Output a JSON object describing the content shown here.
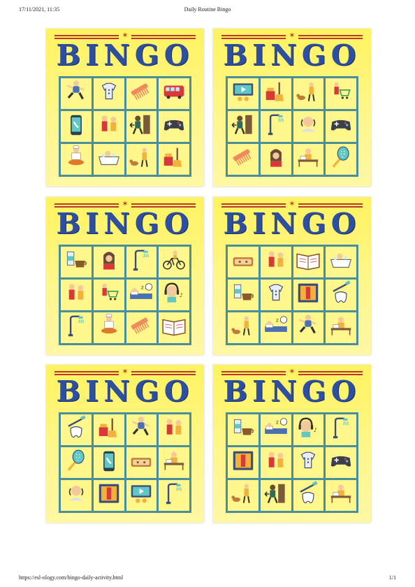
{
  "header": {
    "datetime": "17/11/2021, 11:35",
    "title": "Daily Routine Bingo"
  },
  "footer": {
    "url": "https://esl-ology.com/bingo-daily-activity.html",
    "page": "1/1"
  },
  "bingo_title": "BINGO",
  "cards": [
    {
      "cells": [
        "running-icon",
        "getting-dressed-icon",
        "comb-icon",
        "bus-icon",
        "phone-call-icon",
        "family-icon",
        "going-out-icon",
        "video-game-icon",
        "cooking-icon",
        "bath-icon",
        "walking-dog-icon",
        "cleaning-icon"
      ]
    },
    {
      "cells": [
        "watching-tv-icon",
        "cleaning-icon",
        "walking-dog-icon",
        "shopping-icon",
        "going-out-icon",
        "shower-icon",
        "washing-face-icon",
        "video-game-icon",
        "comb-icon",
        "brushing-hair-icon",
        "homework-icon",
        "hairbrush-icon"
      ]
    },
    {
      "cells": [
        "breakfast-icon",
        "brushing-hair-icon",
        "shower-icon",
        "cycling-icon",
        "family-icon",
        "shopping-icon",
        "sleeping-icon",
        "listening-music-icon",
        "shower-icon",
        "cooking-icon",
        "comb-icon",
        "reading-icon"
      ]
    },
    {
      "cells": [
        "lunchbox-icon",
        "family-icon",
        "reading-icon",
        "bath-icon",
        "breakfast-icon",
        "getting-dressed-icon",
        "studying-icon",
        "brushing-teeth-icon",
        "walking-dog-icon",
        "sleeping-icon",
        "running-icon",
        "homework-icon"
      ]
    },
    {
      "cells": [
        "brushing-teeth-icon",
        "cleaning-icon",
        "running-icon",
        "family-icon",
        "hairbrush-icon",
        "phone-call-icon",
        "lunchbox-icon",
        "homework-icon",
        "washing-face-icon",
        "studying-icon",
        "watching-tv-icon",
        "shower-icon"
      ]
    },
    {
      "cells": [
        "breakfast-icon",
        "sleeping-icon",
        "listening-music-icon",
        "shower-icon",
        "studying-icon",
        "family-icon",
        "getting-dressed-icon",
        "video-game-icon",
        "walking-dog-icon",
        "going-out-icon",
        "brushing-teeth-icon",
        "homework-icon"
      ]
    }
  ],
  "colors": {
    "card_bg": "#fff68c",
    "grid": "#4a8e9a",
    "title": "#2d4fa0",
    "rule": "#b93631"
  }
}
